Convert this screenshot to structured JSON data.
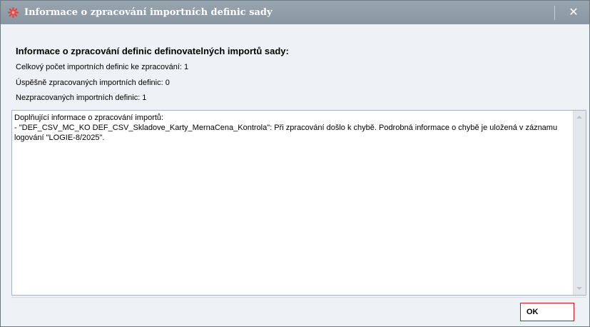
{
  "window": {
    "title": "Informace o zpracování importních definic sady",
    "close_icon": "close-icon",
    "app_icon": "asterisk-icon",
    "colors": {
      "titlebar": "#8f9ba6",
      "ok_border": "#c8191e",
      "icon_red": "#e8403c"
    }
  },
  "content": {
    "heading": "Informace o zpracování definic definovatelných importů sady:",
    "total_label": "Celkový počet importních definic ke zpracování: 1",
    "success_label": "Úspěšně zpracovaných importních definic: 0",
    "failed_label": "Nezpracovaných importních definic: 1",
    "details_text": "Doplňující informace o zpracování importů:\n- \"DEF_CSV_MC_KO DEF_CSV_Skladove_Karty_MernaCena_Kontrola\": Při zpracování došlo k chybě. Podrobná informace o chybě je uložená v záznamu logování \"LOGIE-8/2025\"."
  },
  "buttons": {
    "ok_label": "OK"
  }
}
